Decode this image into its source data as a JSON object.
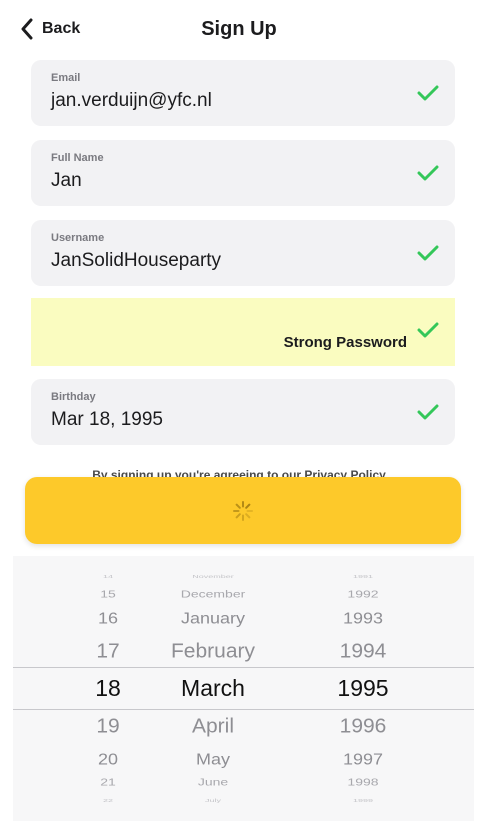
{
  "nav": {
    "back_label": "Back",
    "title": "Sign Up"
  },
  "fields": {
    "email": {
      "label": "Email",
      "value": "jan.verduijn@yfc.nl"
    },
    "full_name": {
      "label": "Full Name",
      "value": "Jan"
    },
    "username": {
      "label": "Username",
      "value": "JanSolidHouseparty"
    },
    "password": {
      "strength_text": "Strong Password"
    },
    "birthday": {
      "label": "Birthday",
      "value": "Mar 18, 1995"
    }
  },
  "terms_text": "By signing up you're agreeing to our Privacy Policy",
  "colors": {
    "accent": "#fdc92a",
    "check": "#34c759",
    "password_bg": "#fafcc0",
    "field_bg": "#f2f2f4"
  },
  "icons": {
    "back": "chevron-left-icon",
    "check": "checkmark-icon",
    "loading": "spinner-icon"
  },
  "picker": {
    "days": [
      "14",
      "15",
      "16",
      "17",
      "18",
      "19",
      "20",
      "21",
      "22"
    ],
    "months": [
      "November",
      "December",
      "January",
      "February",
      "March",
      "April",
      "May",
      "June",
      "July"
    ],
    "years": [
      "1991",
      "1992",
      "1993",
      "1994",
      "1995",
      "1996",
      "1997",
      "1998",
      "1999"
    ],
    "selected": {
      "day": "18",
      "month": "March",
      "year": "1995"
    }
  }
}
